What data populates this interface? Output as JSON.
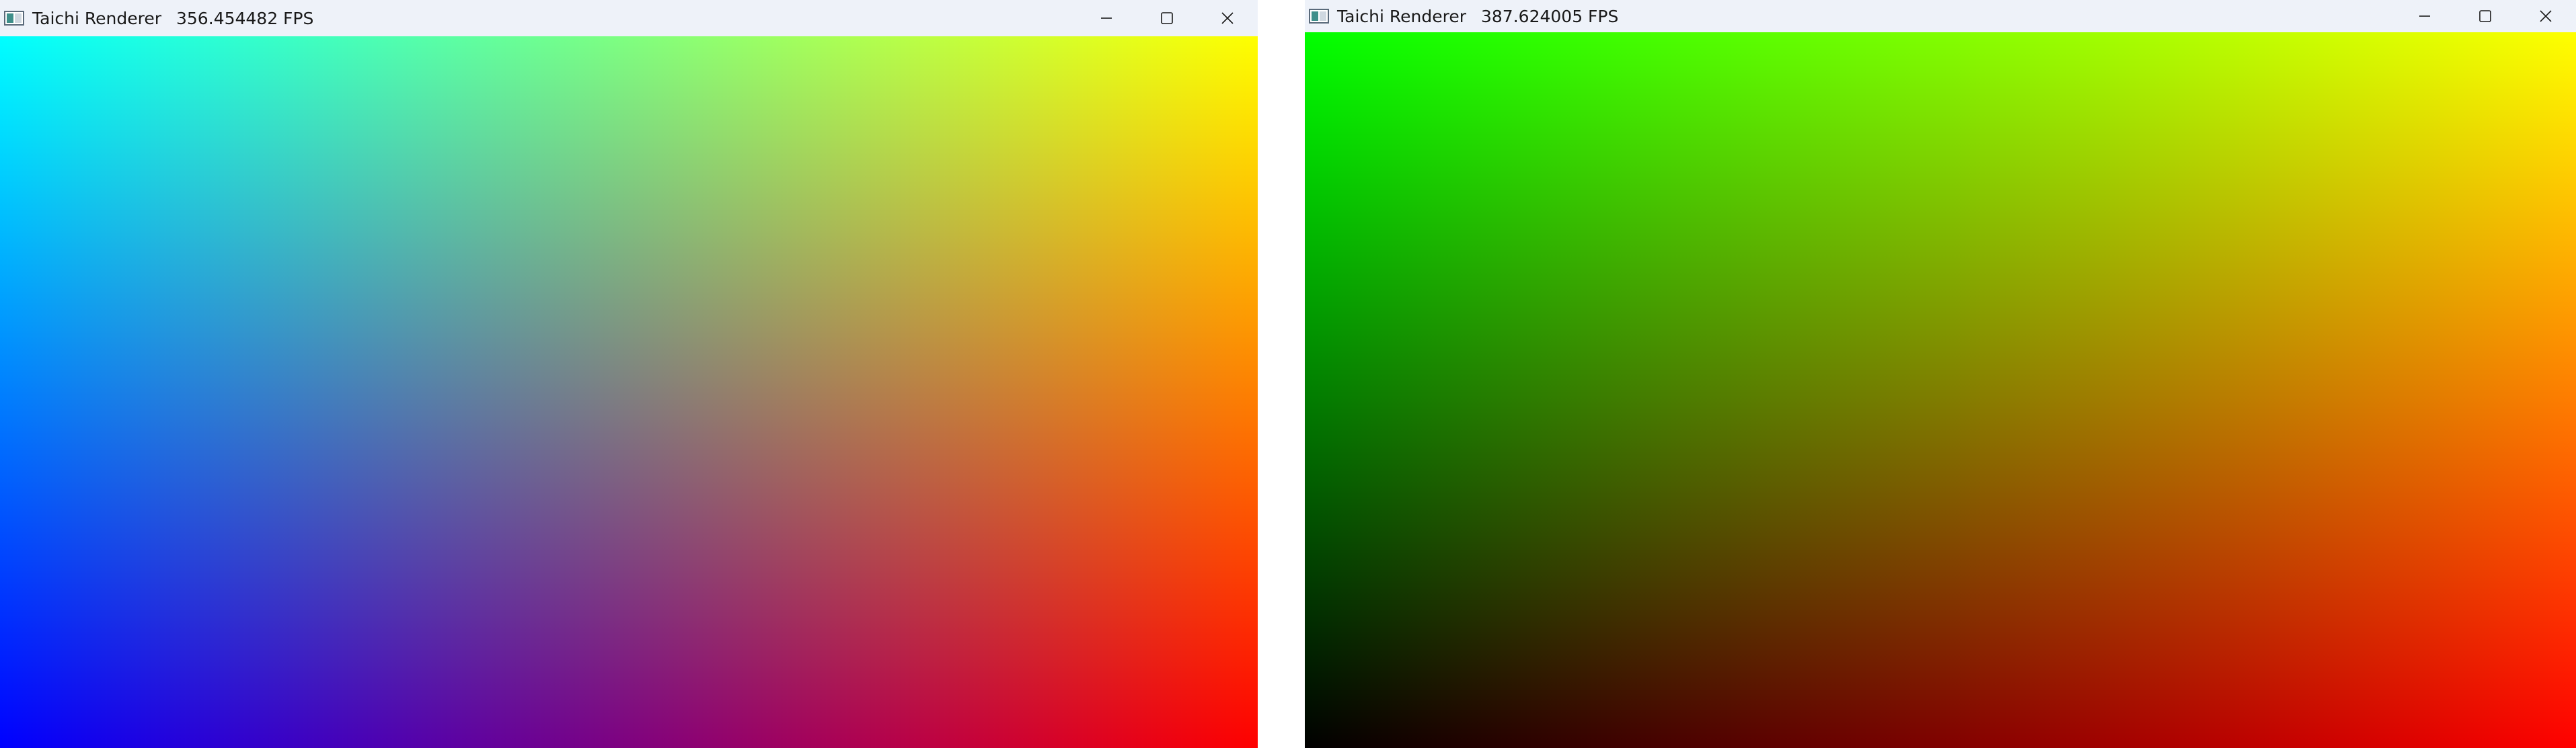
{
  "windows": [
    {
      "title": "Taichi Renderer",
      "fps": "356.454482 FPS",
      "buttons": {
        "minimize": "minimize-icon",
        "maximize": "maximize-icon",
        "close": "close-icon"
      }
    },
    {
      "title": "Taichi Renderer",
      "fps": "387.624005 FPS",
      "buttons": {
        "minimize": "minimize-icon",
        "maximize": "maximize-icon",
        "close": "close-icon"
      }
    }
  ],
  "colors": {
    "titlebar_bg": "#eef2f9",
    "left_canvas_corners": {
      "top_left": "#00ff99",
      "top_right": "#ffff99",
      "bottom_left": "#0000aa",
      "bottom_right": "#ff0099"
    },
    "right_canvas_corners": {
      "top_left": "#00ff00",
      "top_right": "#ffff00",
      "bottom_left": "#000000",
      "bottom_right": "#ff0000"
    }
  }
}
